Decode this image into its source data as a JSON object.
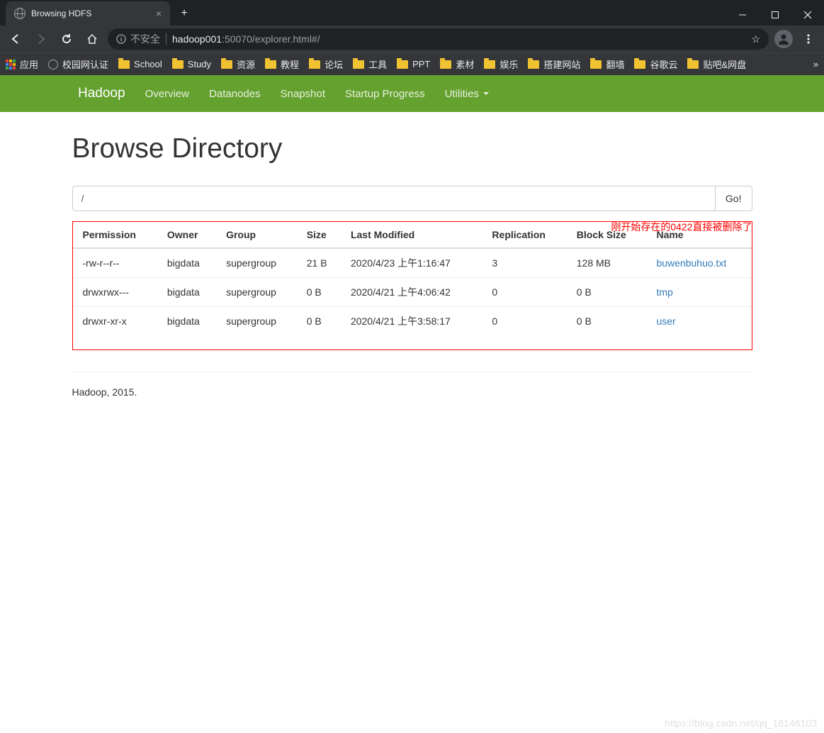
{
  "browser": {
    "tab_title": "Browsing HDFS",
    "insecure_label": "不安全",
    "url_host": "hadoop001",
    "url_rest": ":50070/explorer.html#/",
    "bookmarks": {
      "apps": "应用",
      "items": [
        "校园网认证",
        "School",
        "Study",
        "资源",
        "教程",
        "论坛",
        "工具",
        "PPT",
        "素材",
        "娱乐",
        "搭建网站",
        "翻墙",
        "谷歌云",
        "贴吧&网盘"
      ]
    }
  },
  "nav": {
    "brand": "Hadoop",
    "links": [
      "Overview",
      "Datanodes",
      "Snapshot",
      "Startup Progress",
      "Utilities"
    ]
  },
  "page": {
    "heading": "Browse Directory",
    "path_value": "/",
    "go_label": "Go!",
    "annotation": "刚开始存在的0422直接被删除了",
    "headers": {
      "permission": "Permission",
      "owner": "Owner",
      "group": "Group",
      "size": "Size",
      "modified": "Last Modified",
      "replication": "Replication",
      "blocksize": "Block Size",
      "name": "Name"
    },
    "rows": [
      {
        "permission": "-rw-r--r--",
        "owner": "bigdata",
        "group": "supergroup",
        "size": "21 B",
        "modified": "2020/4/23 上午1:16:47",
        "replication": "3",
        "blocksize": "128 MB",
        "name": "buwenbuhuo.txt"
      },
      {
        "permission": "drwxrwx---",
        "owner": "bigdata",
        "group": "supergroup",
        "size": "0 B",
        "modified": "2020/4/21 上午4:06:42",
        "replication": "0",
        "blocksize": "0 B",
        "name": "tmp"
      },
      {
        "permission": "drwxr-xr-x",
        "owner": "bigdata",
        "group": "supergroup",
        "size": "0 B",
        "modified": "2020/4/21 上午3:58:17",
        "replication": "0",
        "blocksize": "0 B",
        "name": "user"
      }
    ],
    "footer": "Hadoop, 2015."
  },
  "watermark": "https://blog.csdn.net/qq_16146103"
}
